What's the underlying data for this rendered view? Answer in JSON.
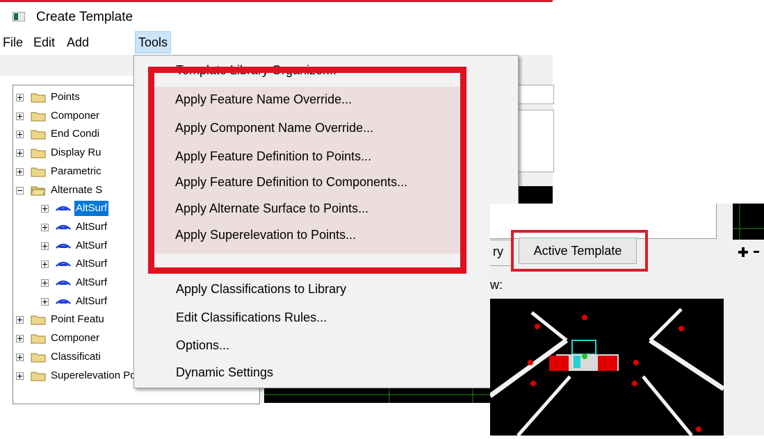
{
  "window": {
    "title": "Create Template"
  },
  "menubar": {
    "items": [
      "File",
      "Edit",
      "Add",
      "Tools"
    ]
  },
  "tree": {
    "items": [
      {
        "label": "Points",
        "indent": 0,
        "expander": "plus",
        "icon": "folder"
      },
      {
        "label": "Componer",
        "indent": 0,
        "expander": "plus",
        "icon": "folder"
      },
      {
        "label": "End Condi",
        "indent": 0,
        "expander": "plus",
        "icon": "folder"
      },
      {
        "label": "Display Ru",
        "indent": 0,
        "expander": "plus",
        "icon": "folder"
      },
      {
        "label": "Parametric",
        "indent": 0,
        "expander": "plus",
        "icon": "folder"
      },
      {
        "label": "Alternate S",
        "indent": 0,
        "expander": "minus",
        "icon": "folder-open"
      },
      {
        "label": "AltSurf",
        "indent": 1,
        "expander": "plus",
        "icon": "alt-surface",
        "selected": true
      },
      {
        "label": "AltSurf",
        "indent": 1,
        "expander": "plus",
        "icon": "alt-surface"
      },
      {
        "label": "AltSurf",
        "indent": 1,
        "expander": "plus",
        "icon": "alt-surface"
      },
      {
        "label": "AltSurf",
        "indent": 1,
        "expander": "plus",
        "icon": "alt-surface"
      },
      {
        "label": "AltSurf",
        "indent": 1,
        "expander": "plus",
        "icon": "alt-surface"
      },
      {
        "label": "AltSurf",
        "indent": 1,
        "expander": "plus",
        "icon": "alt-surface"
      },
      {
        "label": "Point Featu",
        "indent": 0,
        "expander": "plus",
        "icon": "folder"
      },
      {
        "label": "Componer",
        "indent": 0,
        "expander": "plus",
        "icon": "folder"
      },
      {
        "label": "Classificati",
        "indent": 0,
        "expander": "plus",
        "icon": "folder"
      },
      {
        "label": "Superelevation Points",
        "indent": 0,
        "expander": "plus",
        "icon": "folder"
      }
    ]
  },
  "tools_menu": {
    "partial_item": "Template Library Organizer...",
    "highlighted_items": [
      "Apply Feature Name Override...",
      "Apply Component Name Override...",
      "Apply Feature Definition to Points...",
      "Apply Feature Definition to Components...",
      "Apply Alternate Surface to Points...",
      "Apply Superelevation to Points..."
    ],
    "items": [
      "Apply Classifications to Library",
      "Edit Classifications Rules...",
      "Options...",
      "Dynamic Settings"
    ]
  },
  "inset": {
    "tab_left_label": "ry",
    "active_tab_label": "Active Template",
    "preview_label": "w:"
  },
  "colors": {
    "highlight": "#e0111f",
    "selection": "#0078d7",
    "menu_hover": "#cce4f7"
  }
}
